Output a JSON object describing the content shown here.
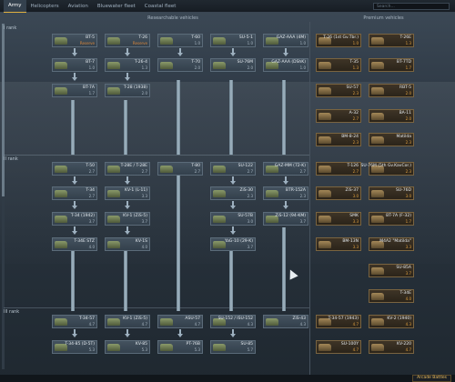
{
  "nav": {
    "tabs": [
      "Army",
      "Helicopters",
      "Aviation",
      "Bluewater fleet",
      "Coastal fleet"
    ],
    "search_placeholder": "Search..."
  },
  "sections": {
    "researchable": "Researchable vehicles",
    "premium": "Premium vehicles"
  },
  "ranks": [
    "I rank",
    "II rank",
    "III rank"
  ],
  "vehicles": [
    {
      "name": "BT-5",
      "br": "Reserve",
      "prem": false
    },
    {
      "name": "T-26",
      "br": "Reserve",
      "prem": false
    },
    {
      "name": "T-60",
      "br": "1.0",
      "prem": false
    },
    {
      "name": "SU-5-1",
      "br": "1.0",
      "prem": false
    },
    {
      "name": "GAZ-AAA (4M)",
      "br": "1.0",
      "prem": false
    },
    {
      "name": "BT-7",
      "br": "1.0",
      "prem": false
    },
    {
      "name": "T-26-4",
      "br": "1.3",
      "prem": false
    },
    {
      "name": "T-70",
      "br": "2.0",
      "prem": false
    },
    {
      "name": "SU-76M",
      "br": "2.0",
      "prem": false
    },
    {
      "name": "GAZ-AAA (DShK)",
      "br": "1.0",
      "prem": false
    },
    {
      "name": "BT-7A",
      "br": "1.7",
      "prem": false
    },
    {
      "name": "T-28 (1938)",
      "br": "2.0",
      "prem": false
    },
    {
      "name": "T-50",
      "br": "2.7",
      "prem": false
    },
    {
      "name": "T-28E / T-28E",
      "br": "2.7",
      "prem": false
    },
    {
      "name": "T-80",
      "br": "2.7",
      "prem": false
    },
    {
      "name": "SU-122",
      "br": "2.7",
      "prem": false
    },
    {
      "name": "GAZ-MM (72-K)",
      "br": "2.7",
      "prem": false
    },
    {
      "name": "T-34",
      "br": "2.7",
      "prem": false
    },
    {
      "name": "KV-1 (L-11)",
      "br": "3.3",
      "prem": false
    },
    {
      "name": "ZiS-30",
      "br": "2.3",
      "prem": false
    },
    {
      "name": "BTR-152A",
      "br": "2.3",
      "prem": false
    },
    {
      "name": "T-34 (1942)",
      "br": "3.7",
      "prem": false
    },
    {
      "name": "KV-1 (ZiS-5)",
      "br": "3.7",
      "prem": false
    },
    {
      "name": "SU-57B",
      "br": "3.0",
      "prem": false
    },
    {
      "name": "ZiS-12 (94-KM)",
      "br": "3.7",
      "prem": false
    },
    {
      "name": "T-34E STZ",
      "br": "4.0",
      "prem": false
    },
    {
      "name": "KV-1S",
      "br": "4.0",
      "prem": false
    },
    {
      "name": "YaG-10 (29-K)",
      "br": "3.7",
      "prem": false
    },
    {
      "name": "T-34-57",
      "br": "4.7",
      "prem": false
    },
    {
      "name": "KV-1 (ZiS-5)",
      "br": "4.7",
      "prem": false
    },
    {
      "name": "ASU-57",
      "br": "4.7",
      "prem": false
    },
    {
      "name": "SU-152 / ISU-152",
      "br": "4.3",
      "prem": false
    },
    {
      "name": "ZiS-43",
      "br": "4.3",
      "prem": false
    },
    {
      "name": "T-34-85 (D-5T)",
      "br": "5.3",
      "prem": false
    },
    {
      "name": "KV-85",
      "br": "5.3",
      "prem": false
    },
    {
      "name": "PT-76B",
      "br": "5.3",
      "prem": false
    },
    {
      "name": "SU-85",
      "br": "5.7",
      "prem": false
    },
    {
      "name": "T-26 (1st Gv.Tbr.)",
      "br": "1.0",
      "prem": true
    },
    {
      "name": "T-26E",
      "br": "1.3",
      "prem": true
    },
    {
      "name": "T-35",
      "br": "1.3",
      "prem": true
    },
    {
      "name": "BT-7TD",
      "br": "1.7",
      "prem": true
    },
    {
      "name": "SU-57",
      "br": "2.3",
      "prem": true
    },
    {
      "name": "RBT-5",
      "br": "2.0",
      "prem": true
    },
    {
      "name": "A-32",
      "br": "2.7",
      "prem": true
    },
    {
      "name": "BA-11",
      "br": "2.0",
      "prem": true
    },
    {
      "name": "BM-8-24",
      "br": "2.3",
      "prem": true
    },
    {
      "name": "Matilda",
      "br": "2.3",
      "prem": true
    },
    {
      "name": "T-126",
      "br": "2.7",
      "prem": true
    },
    {
      "name": "SU-76M (5th Gv.KavCor.)",
      "br": "2.3",
      "prem": true
    },
    {
      "name": "ZiS-37",
      "br": "3.0",
      "prem": true
    },
    {
      "name": "SU-76D",
      "br": "3.0",
      "prem": true
    },
    {
      "name": "SMK",
      "br": "3.3",
      "prem": true
    },
    {
      "name": "BT-7A (F-32)",
      "br": "1.7",
      "prem": true
    },
    {
      "name": "BM-13N",
      "br": "3.3",
      "prem": true
    },
    {
      "name": "M4A2 \"Matilda\"",
      "br": "3.3",
      "prem": true
    },
    {
      "name": "SU-85A",
      "br": "3.7",
      "prem": true
    },
    {
      "name": "T-34E",
      "br": "4.0",
      "prem": true
    },
    {
      "name": "T-34-57 (1943)",
      "br": "4.7",
      "prem": true
    },
    {
      "name": "KV-2 (1940)",
      "br": "4.3",
      "prem": true
    },
    {
      "name": "SU-100Y",
      "br": "4.7",
      "prem": true
    },
    {
      "name": "KV-220",
      "br": "4.7",
      "prem": true
    }
  ],
  "status": {
    "mode": "Arcade Battles"
  }
}
